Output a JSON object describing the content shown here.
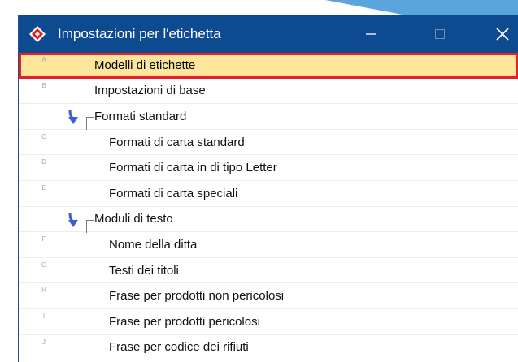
{
  "window": {
    "title": "Impostazioni per l'etichetta"
  },
  "colors": {
    "titlebar": "#0d4a8f",
    "selected_bg": "#fde69b",
    "selected_border": "#e81e2a",
    "arrow": "#3d5bd8"
  },
  "rows": [
    {
      "letter": "A",
      "label": "Modelli di etichette",
      "level": 1,
      "selected": true
    },
    {
      "letter": "B",
      "label": "Impostazioni di base",
      "level": 1
    },
    {
      "letter": "",
      "label": "Formati standard",
      "level": 1,
      "group": true
    },
    {
      "letter": "C",
      "label": "Formati di carta standard",
      "level": 2
    },
    {
      "letter": "D",
      "label": "Formati di carta in di tipo Letter",
      "level": 2
    },
    {
      "letter": "E",
      "label": "Formati di carta speciali",
      "level": 2
    },
    {
      "letter": "",
      "label": "Moduli di testo",
      "level": 1,
      "group": true
    },
    {
      "letter": "F",
      "label": "Nome della ditta",
      "level": 2
    },
    {
      "letter": "G",
      "label": "Testi dei titoli",
      "level": 2
    },
    {
      "letter": "H",
      "label": "Frase per prodotti non pericolosi",
      "level": 2
    },
    {
      "letter": "I",
      "label": "Frase per prodotti pericolosi",
      "level": 2
    },
    {
      "letter": "J",
      "label": "Frase per codice dei rifiuti",
      "level": 2
    }
  ]
}
